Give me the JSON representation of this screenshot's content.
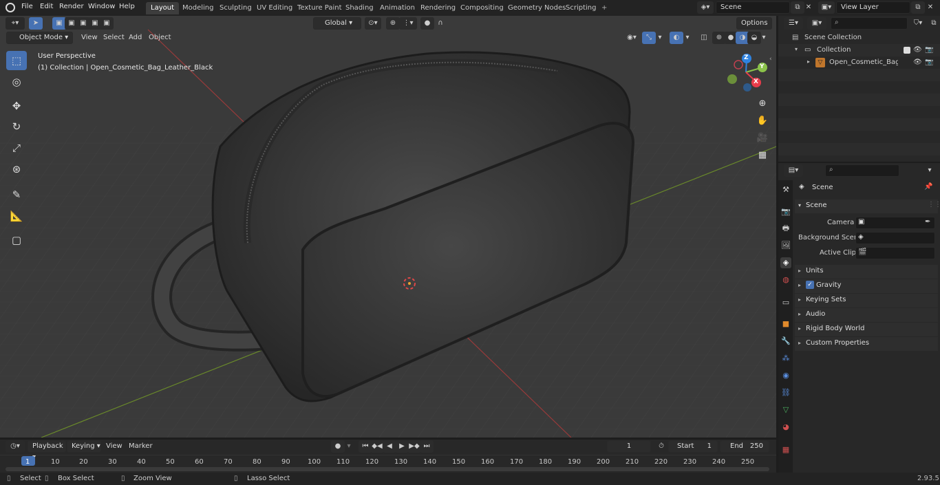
{
  "topbar": {
    "menus": [
      "File",
      "Edit",
      "Render",
      "Window",
      "Help"
    ],
    "workspaces": [
      "Layout",
      "Modeling",
      "Sculpting",
      "UV Editing",
      "Texture Paint",
      "Shading",
      "Animation",
      "Rendering",
      "Compositing",
      "Geometry Nodes",
      "Scripting"
    ],
    "active_workspace": "Layout",
    "add_tab": "+",
    "scene": "Scene",
    "view_layer": "View Layer"
  },
  "viewport": {
    "transform_orientation": "Global",
    "options": "Options",
    "mode": "Object Mode",
    "menus": [
      "View",
      "Select",
      "Add",
      "Object"
    ],
    "perspective": "User Perspective",
    "collection_info": "(1) Collection | Open_Cosmetic_Bag_Leather_Black",
    "axes": {
      "z": "Z",
      "y": "Y",
      "x": "X"
    }
  },
  "outliner": {
    "scene_collection": "Scene Collection",
    "collection": "Collection",
    "object": "Open_Cosmetic_Bag_Lea"
  },
  "properties": {
    "breadcrumb": "Scene",
    "panel": "Scene",
    "camera_label": "Camera",
    "background_label": "Background Scene",
    "clip_label": "Active Clip",
    "sections": [
      "Units",
      "Gravity",
      "Keying Sets",
      "Audio",
      "Rigid Body World",
      "Custom Properties"
    ]
  },
  "timeline": {
    "menus": [
      "Playback",
      "Keying",
      "View",
      "Marker"
    ],
    "current_frame": "1",
    "start_label": "Start",
    "start": "1",
    "end_label": "End",
    "end": "250",
    "ticks": [
      "1",
      "10",
      "20",
      "30",
      "40",
      "50",
      "60",
      "70",
      "80",
      "90",
      "100",
      "110",
      "120",
      "130",
      "140",
      "150",
      "160",
      "170",
      "180",
      "190",
      "200",
      "210",
      "220",
      "230",
      "240",
      "250"
    ]
  },
  "statusbar": {
    "select": "Select",
    "box_select": "Box Select",
    "zoom_view": "Zoom View",
    "lasso_select": "Lasso Select",
    "version": "2.93.5"
  },
  "colors": {
    "accent": "#4772b3",
    "x_axis": "#e83c4b",
    "y_axis": "#8bc34a",
    "z_axis": "#2f83e0"
  }
}
